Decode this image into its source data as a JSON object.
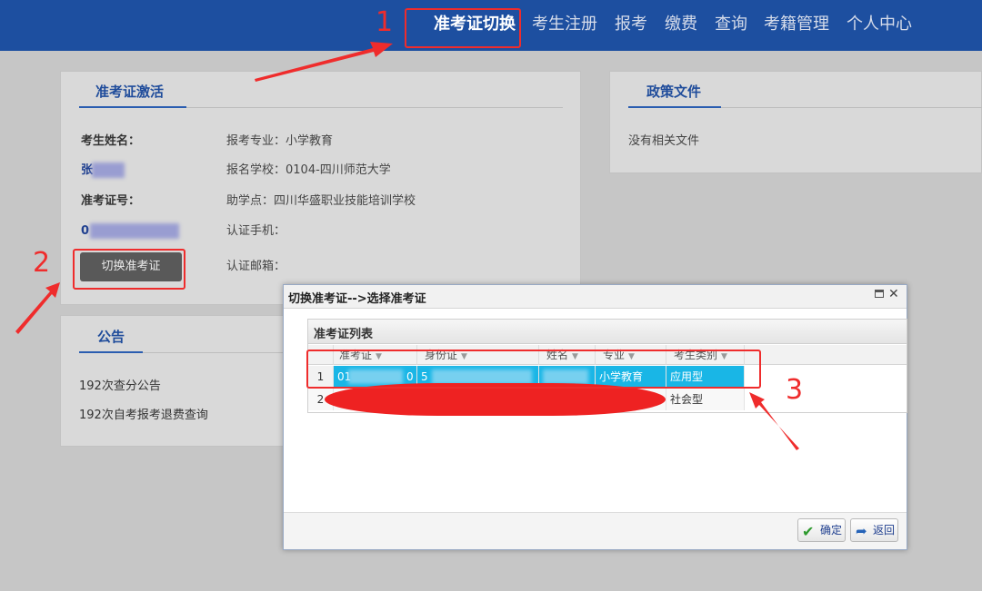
{
  "nav": {
    "items": [
      {
        "label": "准考证切换",
        "active": true
      },
      {
        "label": "考生注册"
      },
      {
        "label": "报考"
      },
      {
        "label": "缴费"
      },
      {
        "label": "查询"
      },
      {
        "label": "考籍管理"
      },
      {
        "label": "个人中心"
      }
    ]
  },
  "activation_panel": {
    "title": "准考证激活",
    "name_label": "考生姓名：",
    "name_value": "张",
    "ticket_label": "准考证号：",
    "ticket_value": "0",
    "major": "报考专业：小学教育",
    "school": "报名学校：0104-四川师范大学",
    "study_center": "助学点：四川华盛职业技能培训学校",
    "phone": "认证手机：",
    "email": "认证邮箱：",
    "switch_button": "切换准考证"
  },
  "policy_panel": {
    "title": "政策文件",
    "empty_text": "没有相关文件"
  },
  "notice_panel": {
    "title": "公告",
    "items": [
      "192次查分公告",
      "192次自考报考退费查询"
    ]
  },
  "modal": {
    "title": "切换准考证-->选择准考证",
    "grid_title": "准考证列表",
    "columns": [
      "准考证",
      "身份证",
      "姓名",
      "专业",
      "考生类别"
    ],
    "rows": [
      {
        "index": "1",
        "ticket": "01",
        "ticket_tail": "0",
        "id_card": "5",
        "name": "",
        "major": "小学教育",
        "category": "应用型",
        "selected": true
      },
      {
        "index": "2",
        "ticket": "",
        "id_card": "",
        "name": "",
        "major": "",
        "category": "社会型",
        "selected": false
      }
    ],
    "confirm_button": "确定",
    "back_button": "返回"
  },
  "annotations": {
    "step1": "1",
    "step2": "2",
    "step3": "3",
    "color": "#ef2c2c"
  },
  "colors": {
    "nav_bg": "#1d4fa0",
    "selected_row": "#19b6e6",
    "title_blue": "#1f4c9b"
  }
}
